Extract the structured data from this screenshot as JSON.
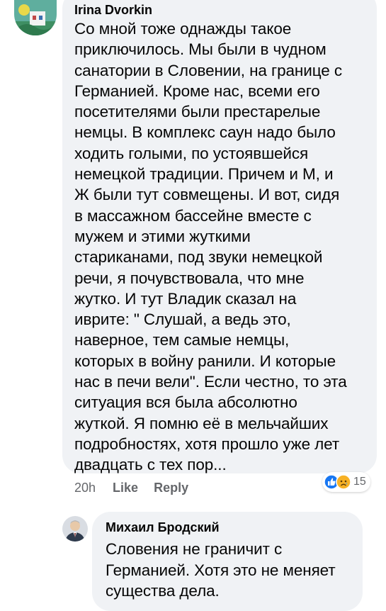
{
  "comments": [
    {
      "author": "Irina Dvorkin",
      "text": "Со мной тоже однажды такое\nприключилось. Мы были в чудном\nсанатории в Словении, на границе с\nГерманией. Кроме нас, всеми его\nпосетителями были престарелые\nнемцы. В комплекс саун надо было\nходить голыми, по устоявшейся\nнемецкой традиции. Причем и М, и\nЖ были тут совмещены. И вот, сидя\nв массажном бассейне вместе с\nмужем и этими жуткими\nстариканами, под звуки немецкой\nречи, я почувствовала, что мне\nжутко. И тут Владик сказал на\nиврите: \" Слушай, а ведь это,\nнаверное, тем самые немцы,\nкоторых в войну ранили. И которые\nнас в печи вели\". Если честно, то эта\nситуация вся была абсолютно\nжуткой. Я помню её в мельчайших\nподробностях, хотя прошло уже лет\nдвадцать с тех пор...",
      "time": "20h",
      "like_label": "Like",
      "reply_label": "Reply",
      "reactions": {
        "icons": [
          "like-reaction-icon",
          "sad-reaction-icon"
        ],
        "count": "15",
        "colors": {
          "like": "#1877f2",
          "sad": "#f7b125"
        }
      }
    },
    {
      "author": "Михаил Бродский",
      "text": "Словения не граничит с\nГерманией. Хотя это не меняет\nсущества дела."
    }
  ],
  "colors": {
    "bubble": "#f0f2f5",
    "text": "#050505",
    "secondary_text": "#65676b"
  }
}
